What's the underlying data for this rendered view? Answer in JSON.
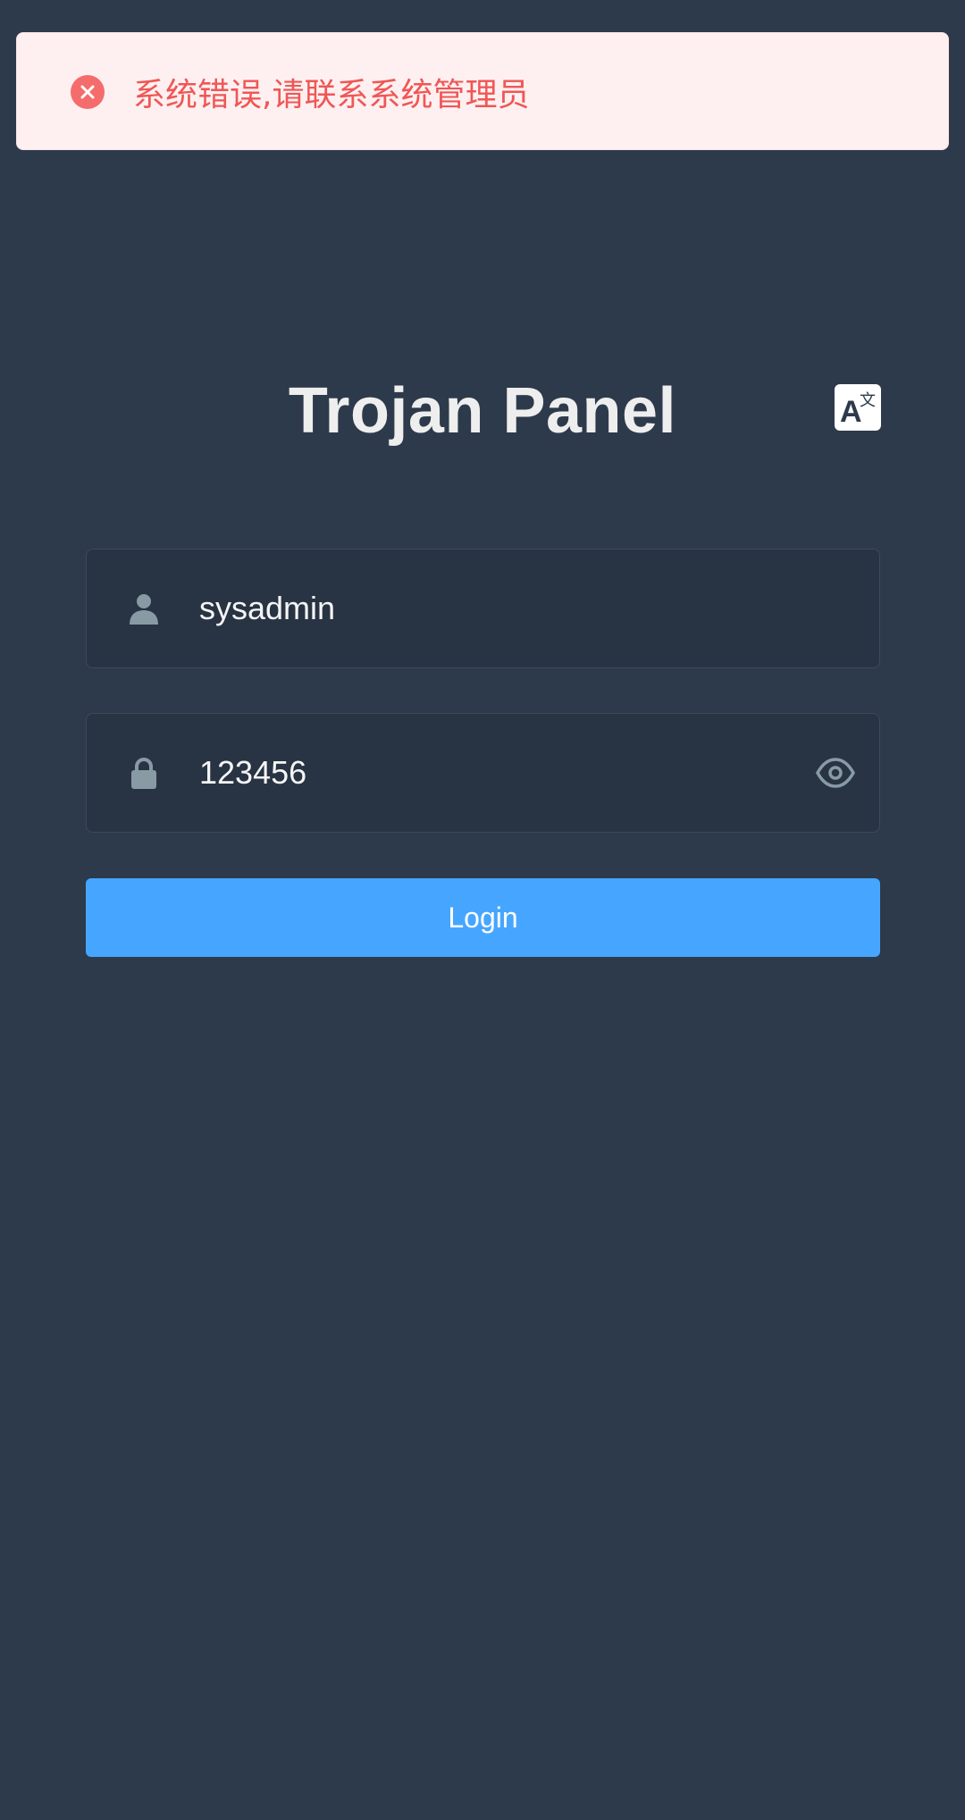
{
  "toast": {
    "type": "error",
    "message": "系统错误,请联系系统管理员",
    "icon": "error-circle-icon",
    "color": "#f05656",
    "background": "#fef0f0"
  },
  "header": {
    "title": "Trojan Panel",
    "language_icon": "translate-icon"
  },
  "form": {
    "username": {
      "icon": "user-icon",
      "value": "sysadmin"
    },
    "password": {
      "icon": "lock-icon",
      "value": "123456",
      "toggle_icon": "eye-icon"
    },
    "login_label": "Login"
  },
  "colors": {
    "background": "#2d3a4b",
    "input_background": "#283443",
    "accent": "#46a6ff",
    "icon_gray": "#889aa4"
  }
}
